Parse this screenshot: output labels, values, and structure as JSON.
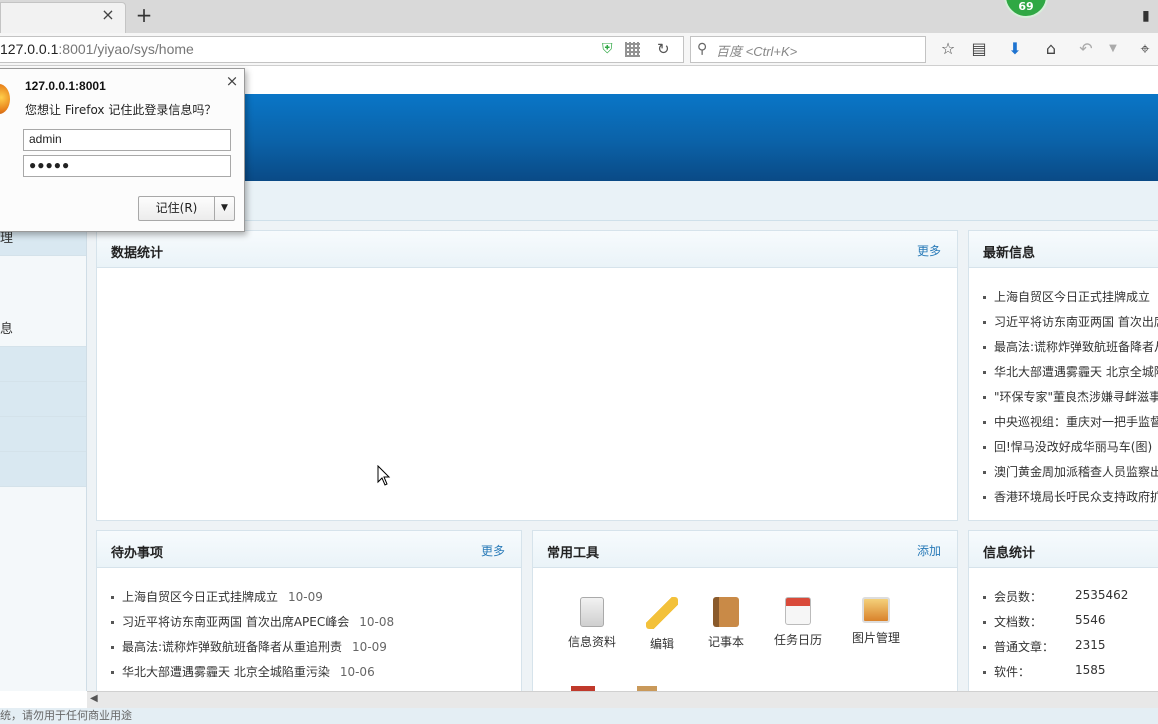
{
  "browser": {
    "tab_close": "×",
    "new_tab": "+",
    "badge": "69",
    "url_host": "127.0.0.1",
    "url_rest": ":8001/yiyao/sys/home",
    "search_placeholder": "百度 <Ctrl+K>"
  },
  "popup": {
    "host": "127.0.0.1:8001",
    "message": "您想让 Firefox 记住此登录信息吗？",
    "username": "admin",
    "password": "●●●●●",
    "remember_label": "记住(R)",
    "close": "×",
    "dropdown": "▼"
  },
  "sidebar": {
    "items": [
      "理",
      "",
      "息",
      "",
      "",
      "",
      ""
    ]
  },
  "panels": {
    "stats": {
      "title": "数据统计",
      "more": "更多"
    },
    "latest": {
      "title": "最新信息",
      "items": [
        "上海自贸区今日正式挂牌成立",
        "习近平将访东南亚两国 首次出席",
        "最高法:谎称炸弹致航班备降者从",
        "华北大部遭遇雾霾天 北京全城陷",
        "\"环保专家\"董良杰涉嫌寻衅滋事",
        "中央巡视组：重庆对一把手监督",
        "回!悍马没改好成华丽马车(图)",
        "澳门黄金周加派稽查人员监察出",
        "香港环境局长吁民众支持政府扩"
      ]
    },
    "todo": {
      "title": "待办事项",
      "more": "更多",
      "items": [
        {
          "text": "上海自贸区今日正式挂牌成立",
          "date": "10-09"
        },
        {
          "text": "习近平将访东南亚两国 首次出席APEC峰会",
          "date": "10-08"
        },
        {
          "text": "最高法:谎称炸弹致航班备降者从重追刑责",
          "date": "10-09"
        },
        {
          "text": "华北大部遭遇雾霾天 北京全城陷重污染",
          "date": "10-06"
        }
      ]
    },
    "tools": {
      "title": "常用工具",
      "add": "添加",
      "items": [
        "信息资料",
        "编辑",
        "记事本",
        "任务日历",
        "图片管理"
      ]
    },
    "info": {
      "title": "信息统计",
      "rows": [
        {
          "label": "会员数：",
          "value": "2535462"
        },
        {
          "label": "文档数：",
          "value": "5546"
        },
        {
          "label": "普通文章：",
          "value": "2315"
        },
        {
          "label": "软件：",
          "value": "1585"
        }
      ]
    }
  },
  "status_text": "统，请勿用于任何商业用途",
  "colors": {
    "header_blue": "#0b62a8",
    "accent_link": "#2a7bb8",
    "badge_green": "#2fa844"
  }
}
